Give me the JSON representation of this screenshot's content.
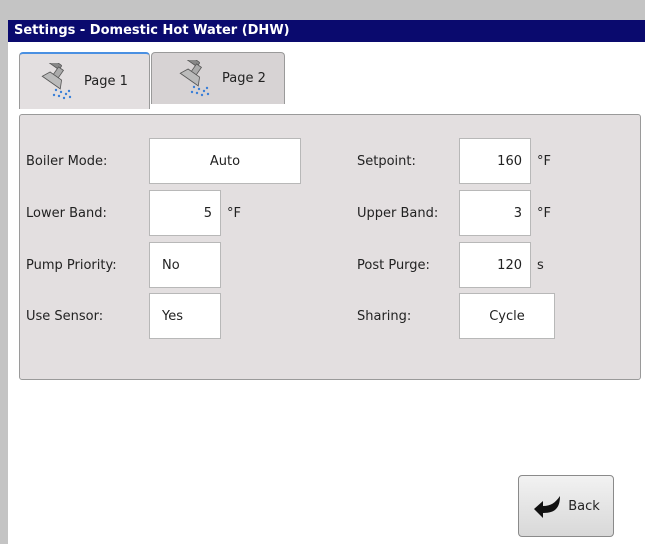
{
  "window": {
    "title": "Settings - Domestic Hot Water (DHW)"
  },
  "tabs": [
    {
      "label": "Page 1",
      "icon": "shower-head-icon",
      "active": true
    },
    {
      "label": "Page 2",
      "icon": "shower-head-icon",
      "active": false
    }
  ],
  "left_fields": [
    {
      "label": "Boiler Mode:",
      "value": "Auto",
      "unit": ""
    },
    {
      "label": "Lower Band:",
      "value": "5",
      "unit": "°F"
    },
    {
      "label": "Pump Priority:",
      "value": "No",
      "unit": ""
    },
    {
      "label": "Use Sensor:",
      "value": "Yes",
      "unit": ""
    }
  ],
  "right_fields": [
    {
      "label": "Setpoint:",
      "value": "160",
      "unit": "°F"
    },
    {
      "label": "Upper Band:",
      "value": "3",
      "unit": "°F"
    },
    {
      "label": "Post Purge:",
      "value": "120",
      "unit": "s"
    },
    {
      "label": "Sharing:",
      "value": "Cycle",
      "unit": ""
    }
  ],
  "back_button": {
    "label": "Back",
    "icon": "back-arrow-icon"
  },
  "colors": {
    "title_bar": "#0a0a6e",
    "panel": "#e3dfe0",
    "tab_accent": "#4a90e2"
  }
}
